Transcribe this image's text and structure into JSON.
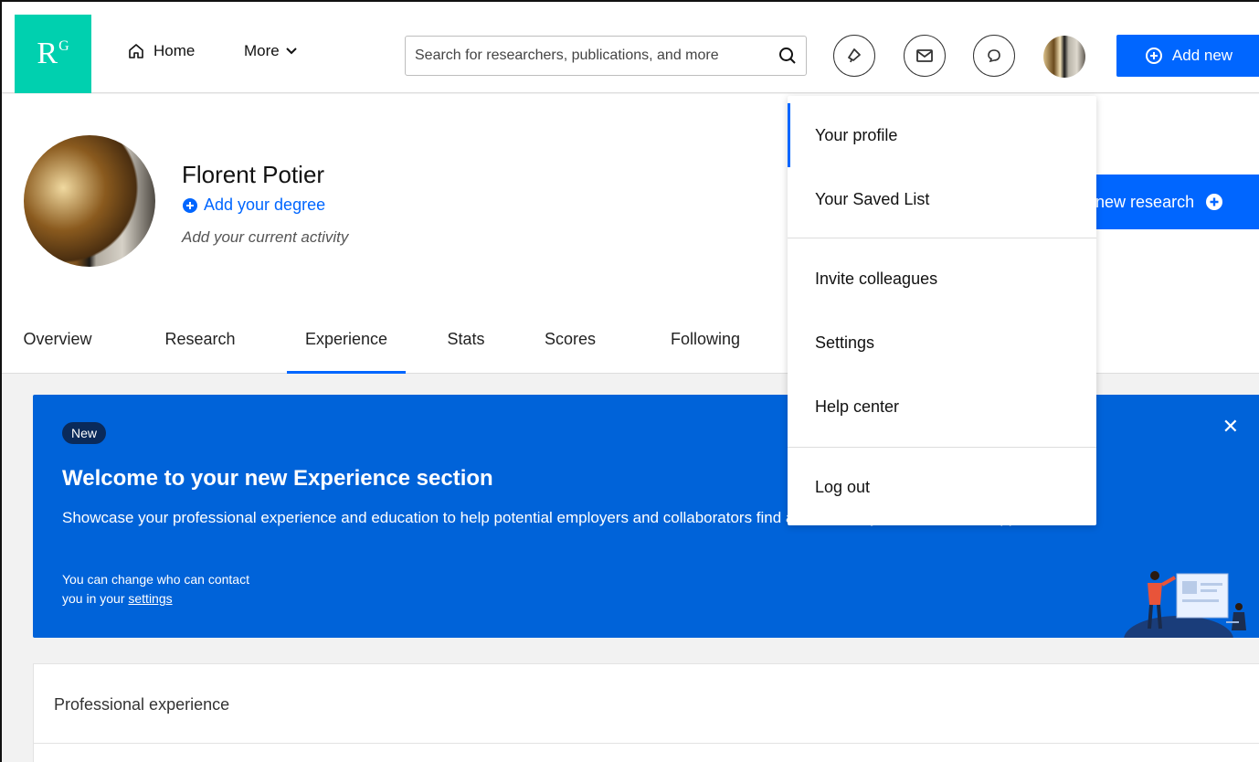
{
  "colors": {
    "brand_teal": "#00d0af",
    "primary_blue": "#0066ff",
    "banner_blue": "#0063d9"
  },
  "nav": {
    "logo_main": "R",
    "logo_super": "G",
    "home_label": "Home",
    "more_label": "More",
    "search_placeholder": "Search for researchers, publications, and more",
    "add_new_label": "Add new"
  },
  "profile": {
    "name": "Florent Potier",
    "add_degree": "Add your degree",
    "activity": "Add your current activity",
    "new_research_label": "Add new research"
  },
  "tabs": [
    {
      "label": "Overview"
    },
    {
      "label": "Research"
    },
    {
      "label": "Experience"
    },
    {
      "label": "Stats"
    },
    {
      "label": "Scores"
    },
    {
      "label": "Following"
    }
  ],
  "banner": {
    "badge": "New",
    "title": "Welcome to your new Experience section",
    "description": "Showcase your professional experience and education to help potential employers and collaborators find and contact you about career opportunities.",
    "contact_line1": "You can change who can contact",
    "contact_line2_prefix": "you in your ",
    "contact_link": "settings",
    "close": "✕"
  },
  "experience": {
    "title": "Professional experience"
  },
  "dropdown": {
    "items": [
      {
        "label": "Your profile"
      },
      {
        "label": "Your Saved List"
      },
      {
        "label": "Invite colleagues"
      },
      {
        "label": "Settings"
      },
      {
        "label": "Help center"
      },
      {
        "label": "Log out"
      }
    ]
  }
}
